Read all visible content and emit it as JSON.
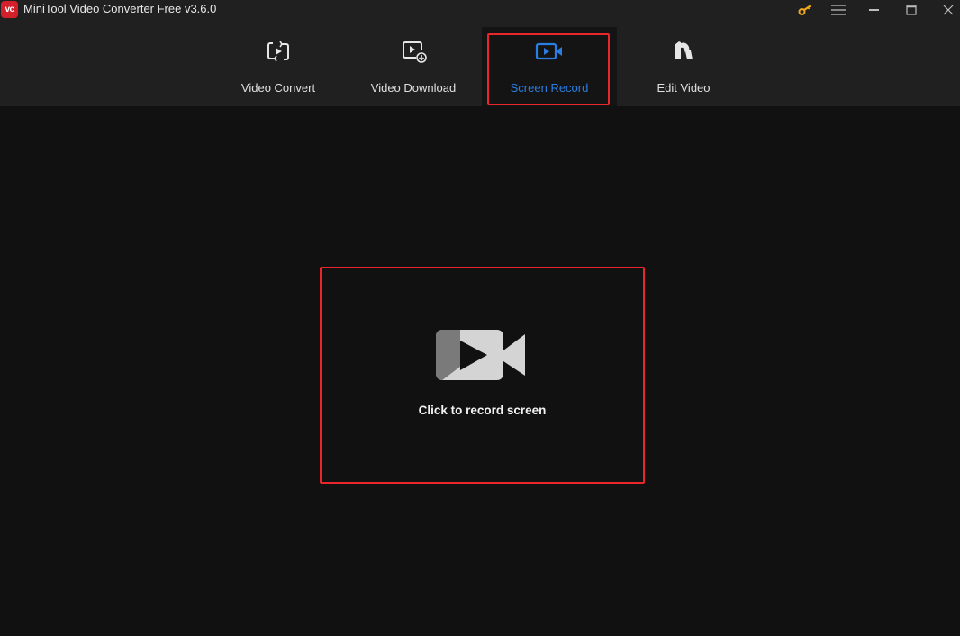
{
  "window": {
    "title": "MiniTool Video Converter Free v3.6.0",
    "logo_text": "vc",
    "controls": [
      {
        "name": "upgrade-key",
        "icon": "key-icon",
        "color": "#f2a81d"
      },
      {
        "name": "menu",
        "icon": "hamburger-menu-icon"
      },
      {
        "name": "minimize",
        "icon": "minimize-icon"
      },
      {
        "name": "maximize",
        "icon": "maximize-icon"
      },
      {
        "name": "close",
        "icon": "close-icon"
      }
    ]
  },
  "nav": {
    "tabs": [
      {
        "label": "Video Convert",
        "icon": "video-convert-icon",
        "active": false
      },
      {
        "label": "Video Download",
        "icon": "video-download-icon",
        "active": false
      },
      {
        "label": "Screen Record",
        "icon": "screen-record-icon",
        "active": true
      },
      {
        "label": "Edit Video",
        "icon": "edit-video-icon",
        "active": false
      }
    ]
  },
  "main": {
    "record_prompt": "Click to record screen",
    "record_icon": "camera-play-icon"
  },
  "colors": {
    "accent": "#2a7de1",
    "highlight_outline": "#e8262b",
    "brand": "#d3202a",
    "key": "#f2a81d"
  }
}
